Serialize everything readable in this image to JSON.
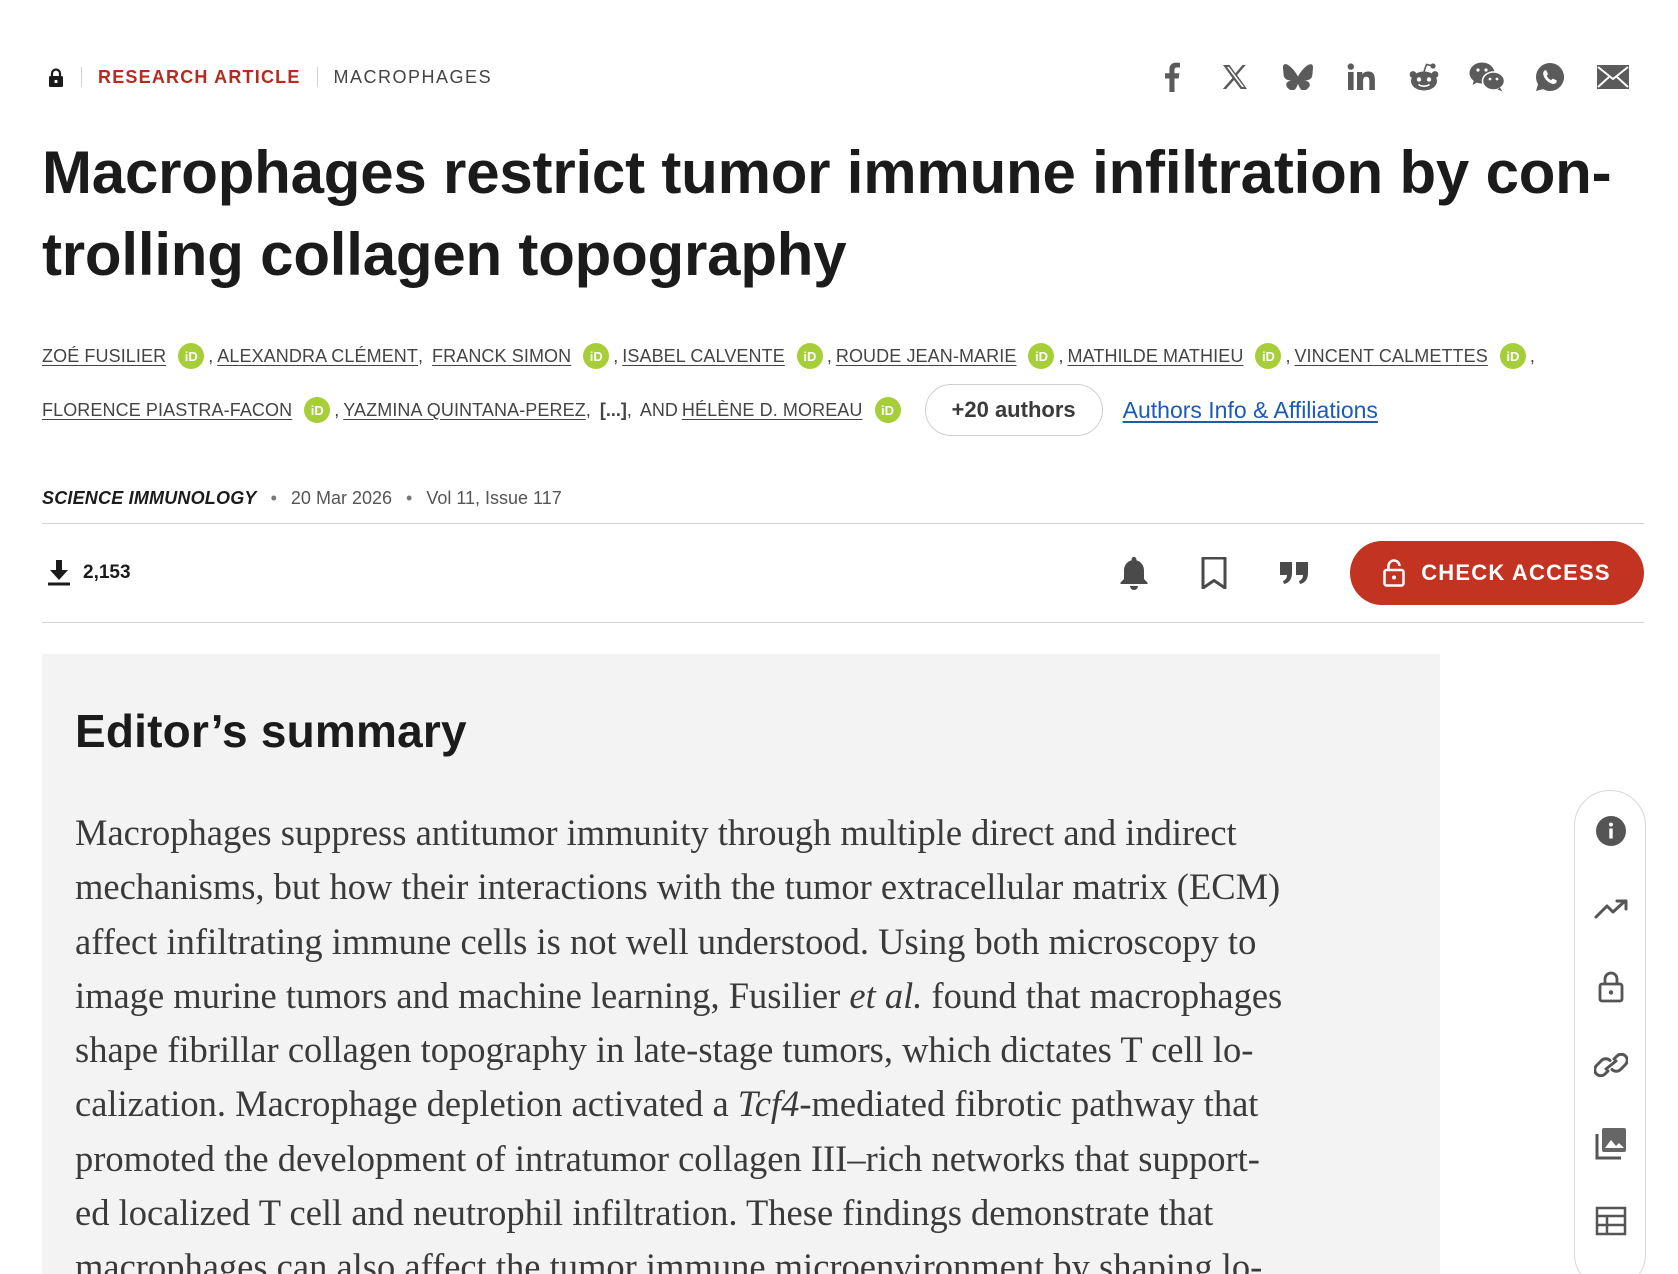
{
  "header": {
    "access_tag": "RESEARCH ARTICLE",
    "subject_tag": "MACROPHAGES",
    "share_icons": [
      "facebook-icon",
      "x-icon",
      "bluesky-icon",
      "linkedin-icon",
      "reddit-icon",
      "wechat-icon",
      "whatsapp-icon",
      "email-icon"
    ]
  },
  "article": {
    "title_line1": "Macrophages restrict tumor immune infiltration by con-",
    "title_line2": "trolling collagen topography"
  },
  "authors": {
    "row1": [
      "ZOÉ FUSILIER",
      "ALEXANDRA CLÉMENT",
      "FRANCK SIMON",
      "ISABEL CALVENTE",
      "ROUDE JEAN-MARIE",
      "MATHILDE MATHIEU",
      "VINCENT CALMETTES"
    ],
    "row2": [
      "FLORENCE PIASTRA-FACON",
      "YAZMINA QUINTANA-PEREZ"
    ],
    "ellipsis": "[...]",
    "and": "AND",
    "last_author": "HÉLÈNE D. MOREAU",
    "orcid_label": "iD",
    "more_label": "+20 authors",
    "affiliations_label": "Authors Info & Affiliations"
  },
  "meta": {
    "journal": "SCIENCE IMMUNOLOGY",
    "date": "20 Mar 2026",
    "volume": "Vol 11, Issue 117"
  },
  "actions": {
    "downloads": "2,153",
    "check_access": "CHECK ACCESS"
  },
  "summary": {
    "heading": "Editor’s summary",
    "lines": [
      [
        "Macrophages suppress antitumor immunity through multiple direct and indirect"
      ],
      [
        "mechanisms, but how their interactions with the tumor extracellular matrix (ECM)"
      ],
      [
        "affect infiltrating immune cells is not well understood. Using both microscopy to"
      ],
      [
        "image murine tumors and machine learning, Fusilier ",
        "et al.",
        " found that macrophages"
      ],
      [
        "shape fibrillar collagen topography in late-stage tumors, which dictates T cell lo-"
      ],
      [
        "calization. Macrophage depletion activated a ",
        "Tcf4",
        "-mediated fibrotic pathway that"
      ],
      [
        "promoted the development of intratumor collagen III–rich networks that support-"
      ],
      [
        "ed localized T cell and neutrophil infiltration. These findings demonstrate that"
      ],
      [
        "macrophages can also affect the tumor immune microenvironment by shaping lo-"
      ]
    ]
  },
  "rail": {
    "icons": [
      "info-icon",
      "trending-icon",
      "lock-icon",
      "link-icon",
      "images-icon",
      "table-icon"
    ]
  }
}
